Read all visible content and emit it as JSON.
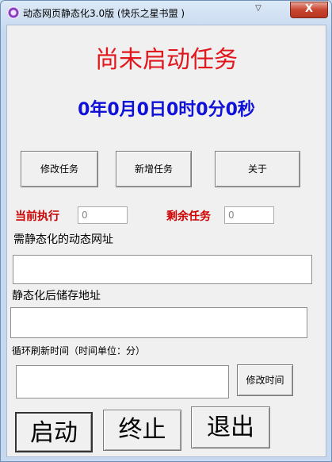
{
  "window": {
    "title": "动态网页静态化3.0版 (快乐之星书盟 )",
    "dropdown_glyph": "▽",
    "close_glyph": "X"
  },
  "status": {
    "task_state": "尚未启动任务",
    "countdown": "0年0月0日0时0分0秒"
  },
  "task_buttons": {
    "modify": "修改任务",
    "add": "新增任务",
    "about": "关于"
  },
  "counters": {
    "current_label": "当前执行",
    "current_value": "0",
    "remaining_label": "剩余任务",
    "remaining_value": "0"
  },
  "form": {
    "dynamic_url_label": "需静态化的动态网址",
    "dynamic_url_value": "",
    "save_path_label": "静态化后储存地址",
    "save_path_value": "",
    "interval_label": "循环刷新时间（时间单位：分）",
    "interval_value": "",
    "modify_time_button": "修改时间"
  },
  "actions": {
    "start": "启动",
    "stop": "终止",
    "exit": "退出"
  }
}
